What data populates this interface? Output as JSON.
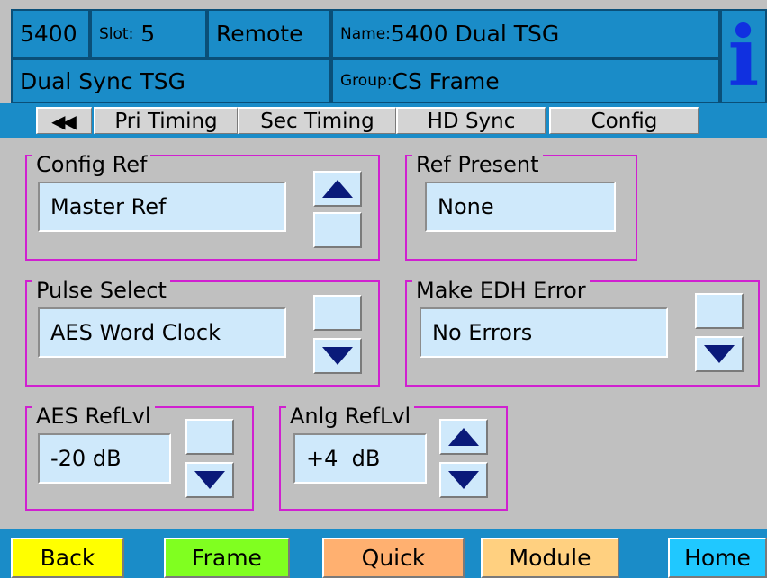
{
  "header": {
    "model": "5400",
    "slot_label": "Slot:",
    "slot_value": "5",
    "mode": "Remote",
    "name_label": "Name:",
    "name_value": "5400 Dual TSG",
    "description": "Dual Sync TSG",
    "group_label": "Group:",
    "group_value": "CS Frame",
    "info_icon": "i"
  },
  "tabs": [
    {
      "label": "◀◀"
    },
    {
      "label": "Pri Timing"
    },
    {
      "label": "Sec Timing"
    },
    {
      "label": "HD Sync"
    },
    {
      "label": "Config"
    }
  ],
  "panels": {
    "config_ref": {
      "title": "Config Ref",
      "value": "Master Ref"
    },
    "ref_present": {
      "title": "Ref Present",
      "value": "None"
    },
    "pulse_select": {
      "title": "Pulse Select",
      "value": "AES Word Clock"
    },
    "make_edh_error": {
      "title": "Make EDH Error",
      "value": "No Errors"
    },
    "aes_ref_lvl": {
      "title": "AES RefLvl",
      "value": "-20 dB"
    },
    "anlg_ref_lvl": {
      "title": "Anlg RefLvl",
      "value": "+4  dB"
    }
  },
  "footer": {
    "buttons": [
      {
        "label": "Back",
        "color": "#ffff00"
      },
      {
        "label": "Frame",
        "color": "#80ff20"
      },
      {
        "label": "Quick",
        "color": "#ffb070"
      },
      {
        "label": "Module",
        "color": "#ffd080"
      },
      {
        "label": "Home",
        "color": "#20c8ff"
      }
    ]
  },
  "colors": {
    "header_bg": "#1a8cc8",
    "panel_border": "#d020d0",
    "value_bg": "#cfe9fb",
    "arrow": "#0a1a7a",
    "body_bg": "#c0c0c0"
  },
  "icons": {
    "up": "arrow-up-icon",
    "down": "arrow-down-icon",
    "info": "info-icon",
    "back_tabs": "double-left-arrow-icon"
  }
}
